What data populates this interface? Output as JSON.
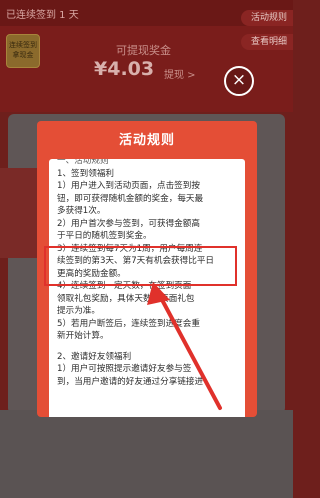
{
  "page": {
    "streak_text": "已连续签到  1  天",
    "rules_pill": "活动规则",
    "records_pill": "查看明细",
    "gift_line1": "连续签到",
    "gift_line2": "拿现金",
    "withdraw_label": "可提现奖金",
    "amount": "¥4.03",
    "amount_link": "提现 >",
    "close_icon": "×"
  },
  "modal": {
    "title": "活动规则",
    "lines": [
      "一、活动规则",
      "1、签到领福利",
      "1）用户进入到活动页面，点击签到按",
      "钮，即可获得随机金额的奖金，每天最",
      "多获得1次。",
      "2）用户首次参与签到，可获得金额高",
      "于平日的随机签到奖金。",
      "3）连续签到每7天为1周，用户每周连",
      "续签到的第3天、第7天有机会获得比平日",
      "更高的奖励金额。",
      "4）连续签到一定天数，在签到页面",
      "领取礼包奖励，具体天数以页面礼包",
      "提示为准。",
      "5）若用户断签后，连续签到进度会重",
      "新开始计算。",
      "2、邀请好友领福利",
      "1）用户可按照提示邀请好友参与签",
      "到，当用户邀请的好友通过分享链接进"
    ]
  },
  "colors": {
    "modal_red": "#e44e36",
    "annotation_red": "#e0312b"
  }
}
